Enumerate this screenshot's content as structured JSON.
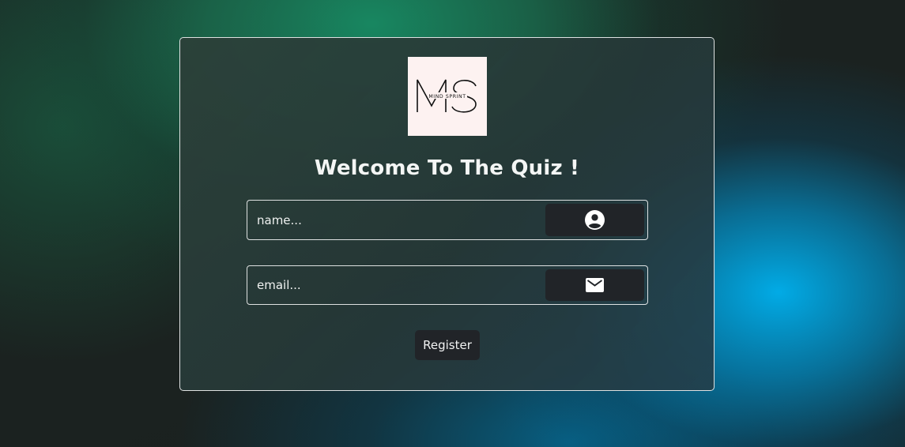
{
  "logo": {
    "letters": "MS",
    "tagline": "MIND SPRINT"
  },
  "page": {
    "title": "Welcome To The Quiz !"
  },
  "form": {
    "name_placeholder": "name...",
    "email_placeholder": "email...",
    "name_icon": "user-circle-icon",
    "email_icon": "envelope-icon",
    "register_label": "Register"
  },
  "colors": {
    "accent_teal": "#00b2f0",
    "accent_green": "#188c64",
    "button_bg": "#212428",
    "logo_bg": "#fdf2f1"
  }
}
